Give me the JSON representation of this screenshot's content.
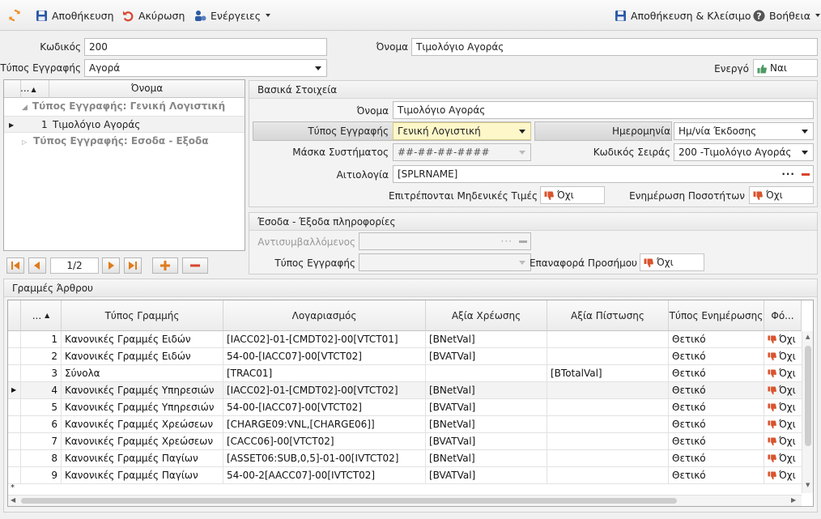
{
  "toolbar": {
    "save": "Αποθήκευση",
    "cancel": "Ακύρωση",
    "actions": "Ενέργειες",
    "save_close": "Αποθήκευση & Κλείσιμο",
    "help": "Βοήθεια"
  },
  "header": {
    "code_label": "Κωδικός",
    "code_value": "200",
    "name_label": "Όνομα",
    "name_value": "Τιμολόγιο Αγοράς",
    "type_label": "Τύπος Εγγραφής",
    "type_value": "Αγορά",
    "active_label": "Ενεργό",
    "active_value": "Ναι"
  },
  "tree": {
    "col_dots": "...",
    "col_name": "Όνομα",
    "groups": [
      {
        "label": "Τύπος Εγγραφής: Γενική Λογιστική"
      },
      {
        "label": "Τύπος Εγγραφής: Εσοδα - Εξοδα"
      }
    ],
    "items": [
      {
        "num": "1",
        "name": "Τιμολόγιο Αγοράς"
      }
    ],
    "pager": "1/2"
  },
  "basic": {
    "title": "Βασικά Στοιχεία",
    "name_label": "Όνομα",
    "name_value": "Τιμολόγιο Αγοράς",
    "type_label": "Τύπος Εγγραφής",
    "type_value": "Γενική Λογιστική",
    "date_label": "Ημερομηνία",
    "date_value": "Ημ/νία Έκδοσης",
    "mask_label": "Μάσκα Συστήματος",
    "mask_value": "##-##-##-####",
    "series_label": "Κωδικός Σειράς",
    "series_value": "200 -Τιμολόγιο Αγοράς",
    "reason_label": "Αιτιολογία",
    "reason_value": "[SPLRNAME]",
    "zero_label": "Επιτρέπονται Μηδενικές Τιμές",
    "zero_value": "Όχι",
    "qty_label": "Ενημέρωση Ποσοτήτων",
    "qty_value": "Όχι"
  },
  "income": {
    "title": "Έσοδα - Έξοδα πληροφορίες",
    "counter_label": "Αντισυμβαλλόμενος",
    "type_label": "Τύπος Εγγραφής",
    "sign_label": "Επαναφορά Προσήμου",
    "sign_value": "Όχι"
  },
  "lines": {
    "title": "Γραμμές Άρθρου",
    "headers": [
      "...",
      "Τύπος Γραμμής",
      "Λογαριασμός",
      "Αξία Χρέωσης",
      "Αξία Πίστωσης",
      "Τύπος Ενημέρωσης",
      "Φό..."
    ],
    "rows": [
      {
        "n": "1",
        "type": "Κανονικές Γραμμές Ειδών",
        "account": "[IACC02]-01-[CMDT02]-00[VTCT01]",
        "debit": "[BNetVal]",
        "credit": "",
        "update": "Θετικό",
        "f": "Όχι"
      },
      {
        "n": "2",
        "type": "Κανονικές Γραμμές Ειδών",
        "account": "54-00-[IACC07]-00[VTCT02]",
        "debit": "[BVATVal]",
        "credit": "",
        "update": "Θετικό",
        "f": "Όχι"
      },
      {
        "n": "3",
        "type": "Σύνολα",
        "account": "[TRAC01]",
        "debit": "",
        "credit": "[BTotalVal]",
        "update": "Θετικό",
        "f": "Όχι"
      },
      {
        "n": "4",
        "type": "Κανονικές Γραμμές Υπηρεσιών",
        "account": "[IACC02]-01-[CMDT02]-00[VTCT02]",
        "debit": "[BNetVal]",
        "credit": "",
        "update": "Θετικό",
        "f": "Όχι"
      },
      {
        "n": "5",
        "type": "Κανονικές Γραμμές Υπηρεσιών",
        "account": "54-00-[IACC07]-00[VTCT02]",
        "debit": "[BVATVal]",
        "credit": "",
        "update": "Θετικό",
        "f": "Όχι"
      },
      {
        "n": "6",
        "type": "Κανονικές Γραμμές Χρεώσεων",
        "account": "[CHARGE09:VNL,[CHARGE06]]",
        "debit": "[BNetVal]",
        "credit": "",
        "update": "Θετικό",
        "f": "Όχι"
      },
      {
        "n": "7",
        "type": "Κανονικές Γραμμές Χρεώσεων",
        "account": "[CACC06]-00[VTCT02]",
        "debit": "[BVATVal]",
        "credit": "",
        "update": "Θετικό",
        "f": "Όχι"
      },
      {
        "n": "8",
        "type": "Κανονικές Γραμμές Παγίων",
        "account": "[ASSET06:SUB,0,5]-01-00[IVTCT02]",
        "debit": "[BNetVal]",
        "credit": "",
        "update": "Θετικό",
        "f": "Όχι"
      },
      {
        "n": "9",
        "type": "Κανονικές Γραμμές Παγίων",
        "account": "54-00-2[AACC07]-00[IVTCT02]",
        "debit": "[BVATVal]",
        "credit": "",
        "update": "Θετικό",
        "f": "Όχι"
      }
    ],
    "new_row_marker": "*"
  }
}
